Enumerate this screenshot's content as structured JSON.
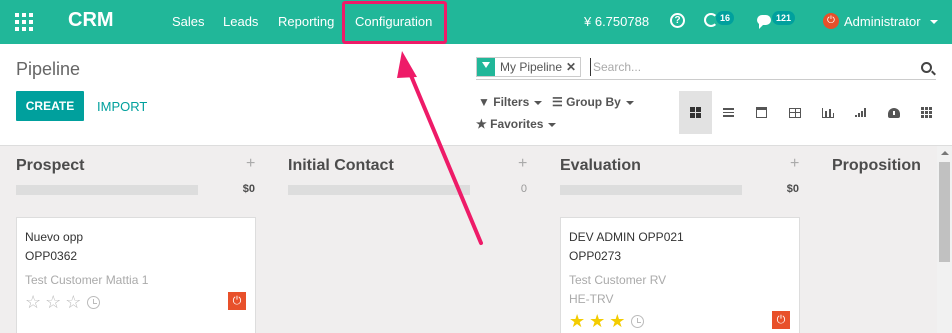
{
  "navbar": {
    "brand": "CRM",
    "menu": [
      "Sales",
      "Leads",
      "Reporting",
      "Configuration"
    ],
    "currency": "¥ 6.750788",
    "activity_count": "16",
    "message_count": "121",
    "user": "Administrator"
  },
  "control_panel": {
    "breadcrumb": "Pipeline",
    "create_label": "CREATE",
    "import_label": "IMPORT",
    "facet": "My Pipeline",
    "search_placeholder": "Search...",
    "filters_label": "Filters",
    "groupby_label": "Group By",
    "favorites_label": "Favorites",
    "views": [
      "kanban",
      "list",
      "calendar",
      "pivot",
      "graph",
      "cohort",
      "dashboard",
      "grid"
    ]
  },
  "columns": [
    {
      "title": "Prospect",
      "total": "$0"
    },
    {
      "title": "Initial Contact",
      "total": "0"
    },
    {
      "title": "Evaluation",
      "total": "$0"
    },
    {
      "title": "Proposition"
    }
  ],
  "cards": [
    {
      "name": "Nuevo opp",
      "ref": "OPP0362",
      "customer": "Test Customer Mattia 1",
      "extra": "",
      "stars": 0
    },
    {
      "name": "DEV ADMIN OPP021",
      "ref": "OPP0273",
      "customer": "Test Customer RV",
      "extra": "HE-TRV",
      "stars": 3
    }
  ],
  "colors": {
    "navbar": "#21b799",
    "primary": "#00a09d",
    "highlight": "#ee1b68",
    "danger": "#e8502a",
    "star": "#f3cc00"
  }
}
